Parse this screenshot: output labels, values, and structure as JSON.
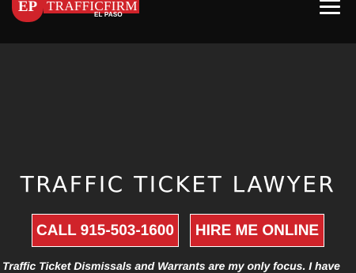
{
  "header": {
    "logo": {
      "badge": "EP",
      "name": "TRAFFICFIRM",
      "city": "EL PASO"
    },
    "menu_icon": "hamburger-menu-icon"
  },
  "hero": {
    "title": "TRAFFIC TICKET LAWYER",
    "call_button": "CALL 915-503-1600",
    "hire_button": "HIRE ME ONLINE",
    "tagline": "Traffic Ticket Dismissals and Warrants are my only focus. I have"
  },
  "colors": {
    "accent": "#d0232a",
    "header_bg": "#0d0d0d",
    "hero_bg": "#252525",
    "text": "#ffffff"
  }
}
